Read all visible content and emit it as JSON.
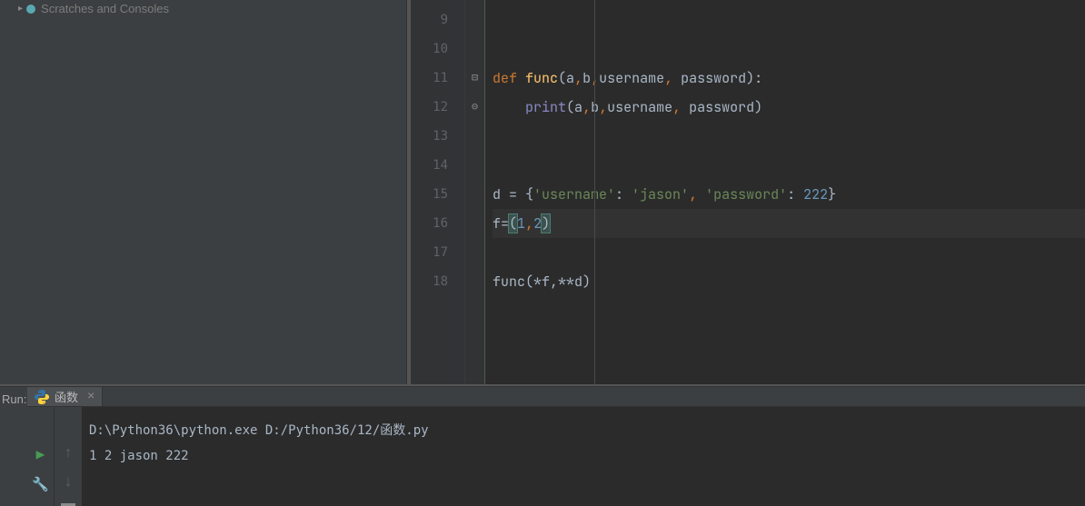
{
  "sidebar": {
    "item_label": "Scratches and Consoles"
  },
  "editor": {
    "lines": {
      "start": 9,
      "l9": "",
      "l10": "",
      "l11_kw": "def ",
      "l11_fn": "func",
      "l11_rest1": "(a",
      "l11_rest2": ",",
      "l11_rest3": "b",
      "l11_rest4": ",",
      "l11_rest5": "username",
      "l11_rest6": ", ",
      "l11_rest7": "password):",
      "l12_builtin": "print",
      "l12_rest1": "(a",
      "l12_rest2": ",",
      "l12_rest3": "b",
      "l12_rest4": ",",
      "l12_rest5": "username",
      "l12_rest6": ", ",
      "l12_rest7": "password)",
      "l13": "",
      "l14": "",
      "l15_a": "d = {",
      "l15_s1": "'username'",
      "l15_b": ": ",
      "l15_s2": "'jason'",
      "l15_c": ", ",
      "l15_s3": "'password'",
      "l15_d": ": ",
      "l15_n1": "222",
      "l15_e": "}",
      "l16_a": "f=",
      "l16_p1": "(",
      "l16_n1": "1",
      "l16_c": ",",
      "l16_n2": "2",
      "l16_p2": ")",
      "l17": "",
      "l18": "func(*f,**d)"
    },
    "line_numbers": [
      "9",
      "10",
      "11",
      "12",
      "13",
      "14",
      "15",
      "16",
      "17",
      "18"
    ]
  },
  "run_panel": {
    "label": "Run:",
    "tab_label": "函数",
    "console_line1": "D:\\Python36\\python.exe D:/Python36/12/函数.py",
    "console_line2": "1 2 jason 222"
  }
}
